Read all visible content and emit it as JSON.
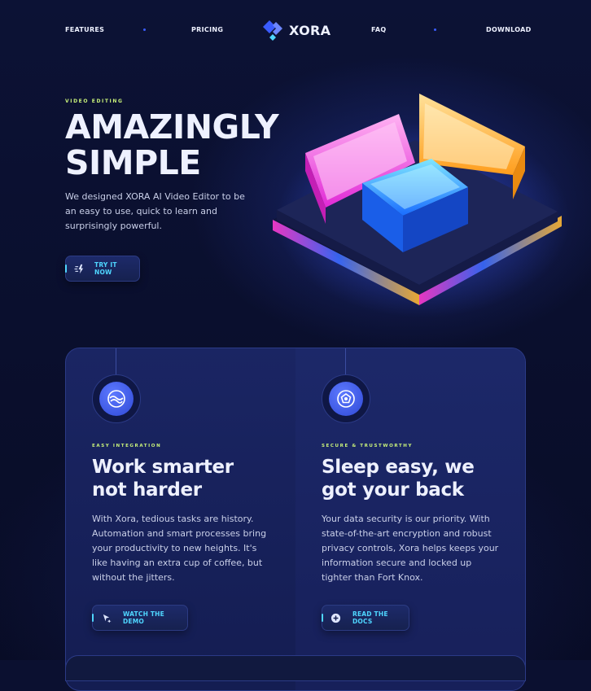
{
  "nav": {
    "features_label": "FEATURES",
    "pricing_label": "PRICING",
    "brand": "XORA",
    "faq_label": "FAQ",
    "download_label": "DOWNLOAD"
  },
  "hero": {
    "eyebrow": "VIDEO EDITING",
    "title_line1": "AMAZINGLY",
    "title_line2": "SIMPLE",
    "description": "We designed XORA AI Video Editor to be an easy to use, quick to learn and surprisingly powerful.",
    "cta_label": "TRY IT NOW",
    "cta_icon": "zap-icon"
  },
  "features": [
    {
      "eyebrow": "EASY INTEGRATION",
      "title_line1": "Work smarter",
      "title_line2": "not harder",
      "description": "With Xora, tedious tasks are history. Automation and smart processes bring your productivity to new heights. It's like having an extra cup of coffee, but without the jitters.",
      "button_label": "WATCH THE DEMO",
      "icon": "swirl-icon",
      "button_icon": "sparkle-cursor-icon"
    },
    {
      "eyebrow": "SECURE & TRUSTWORTHY",
      "title_line1": "Sleep easy, we",
      "title_line2": "got your back",
      "description": "Your data security is our priority. With state-of-the-art encryption and robust privacy controls, Xora helps keeps your information secure and locked up tighter than Fort Knox.",
      "button_label": "READ THE DOCS",
      "icon": "shield-circle-icon",
      "button_icon": "docs-icon"
    }
  ],
  "colors": {
    "background": "#0b1030",
    "accent": "#4fd6ff",
    "eyebrow": "#c9f27a",
    "brand_blue": "#3a5cff"
  }
}
